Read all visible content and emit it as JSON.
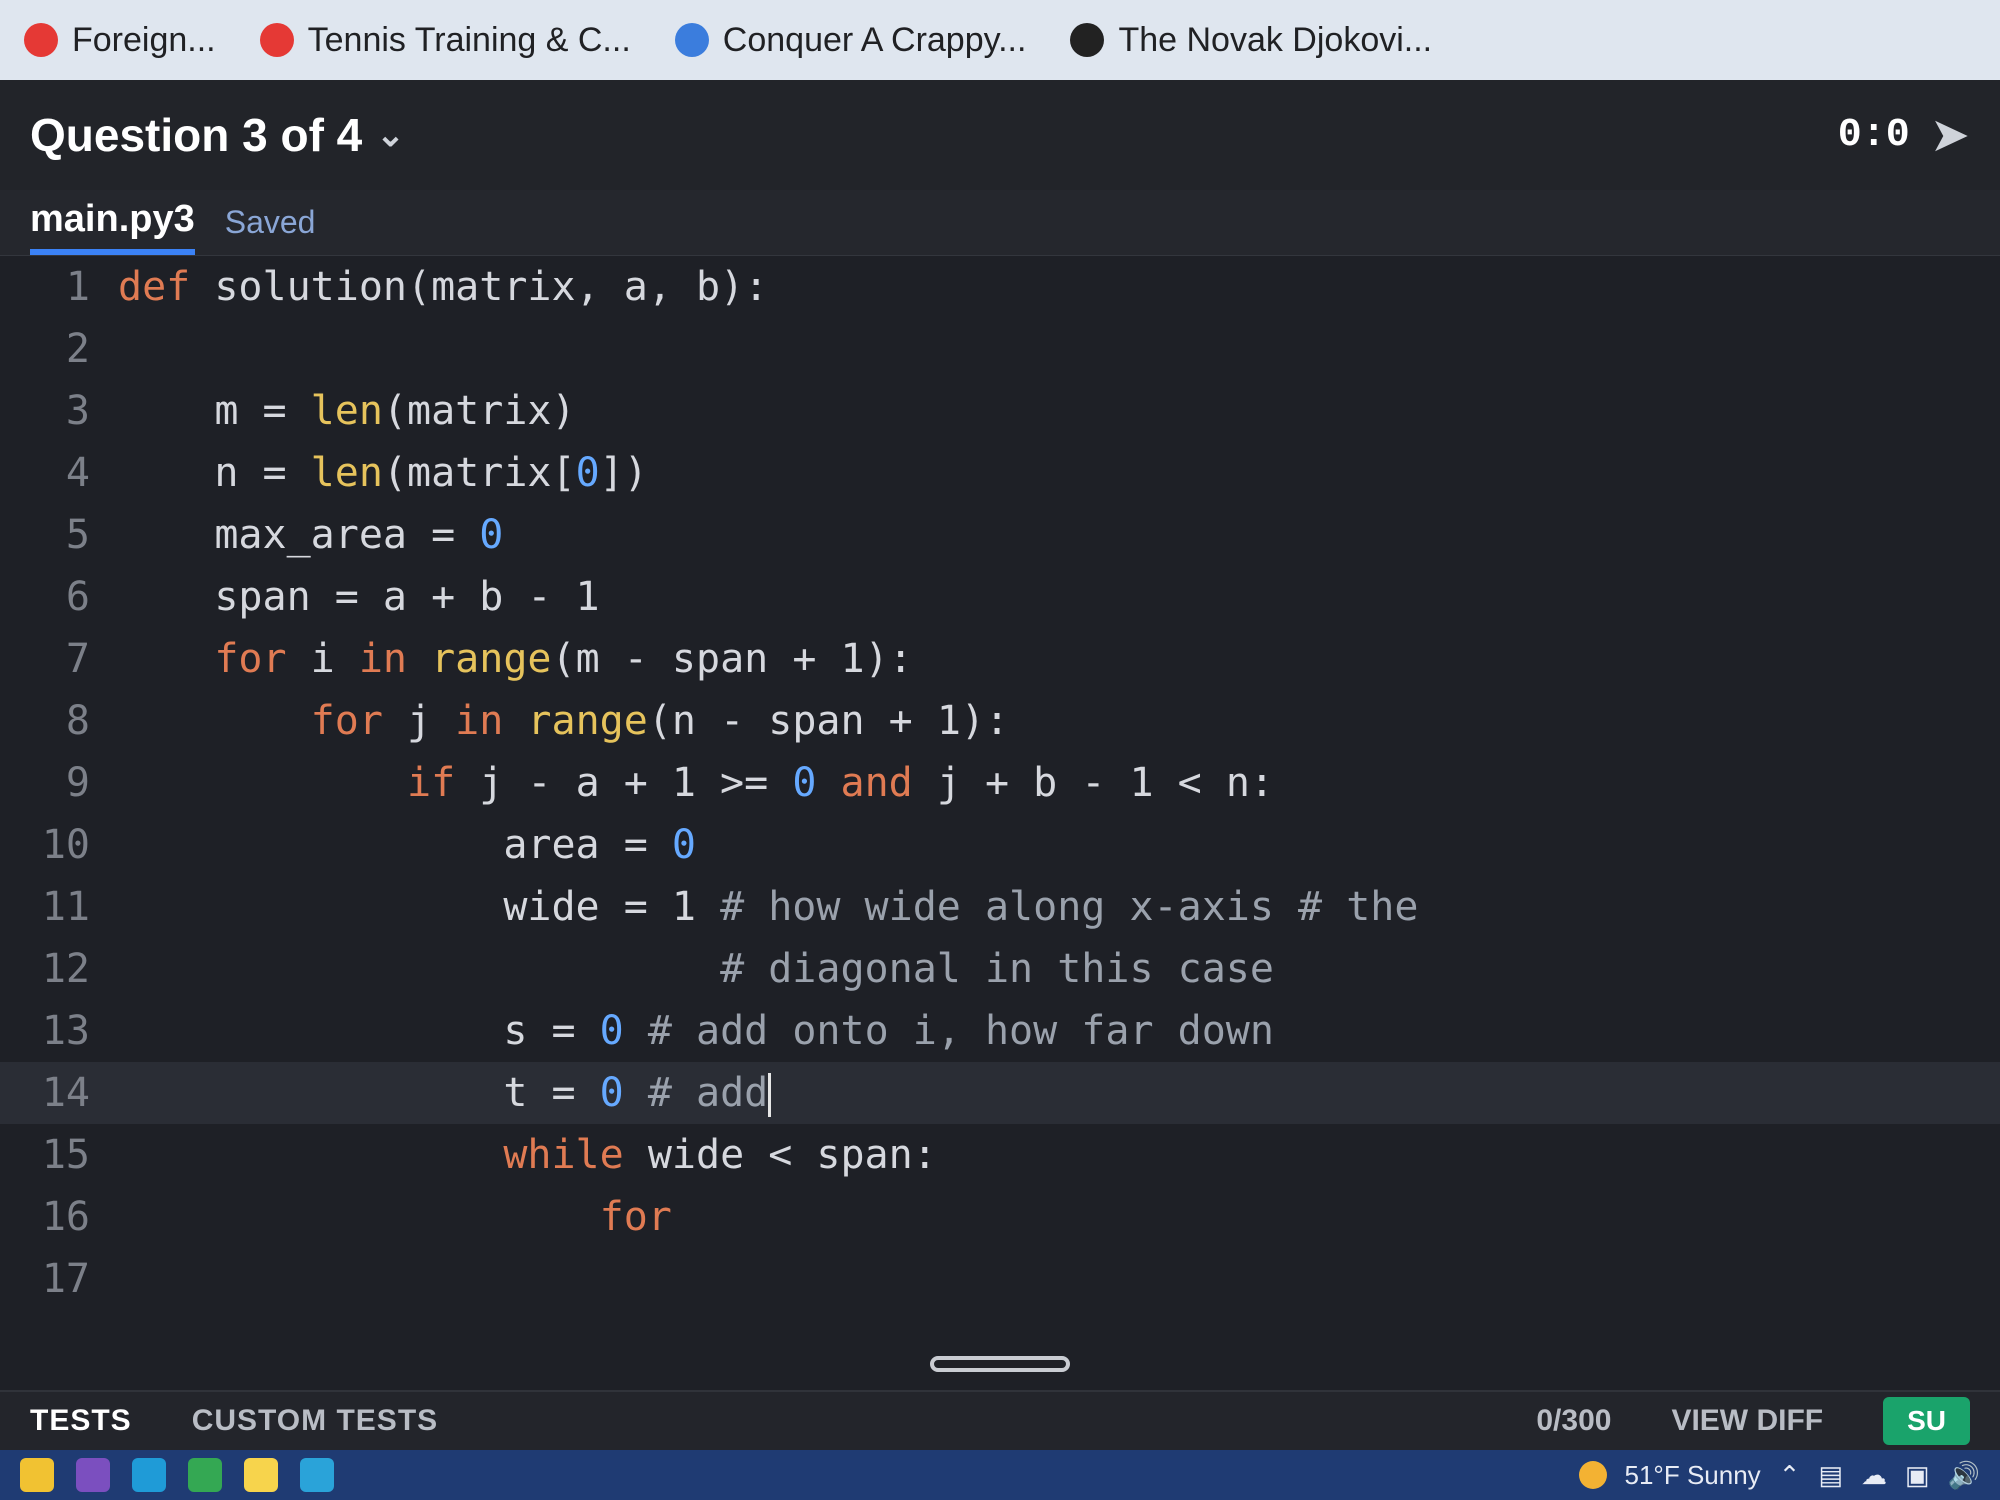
{
  "browser": {
    "bookmarks": [
      {
        "label": "Foreign...",
        "icon": "red-circle-icon"
      },
      {
        "label": "Tennis Training & C...",
        "icon": "red-circle-icon"
      },
      {
        "label": "Conquer A Crappy...",
        "icon": "blue-logo-icon"
      },
      {
        "label": "The Novak Djokovi...",
        "icon": "dark-circle-icon"
      }
    ]
  },
  "header": {
    "question": "Question 3 of 4",
    "timer": "0:0"
  },
  "editor": {
    "file_tab": "main.py3",
    "status": "Saved",
    "lines": [
      {
        "num": "1",
        "text": "def solution(matrix, a, b):"
      },
      {
        "num": "2",
        "text": ""
      },
      {
        "num": "3",
        "text": "    m = len(matrix)"
      },
      {
        "num": "4",
        "text": "    n = len(matrix[0])"
      },
      {
        "num": "5",
        "text": "    max_area = 0"
      },
      {
        "num": "6",
        "text": "    span = a + b - 1"
      },
      {
        "num": "7",
        "text": "    for i in range(m - span + 1):"
      },
      {
        "num": "8",
        "text": "        for j in range(n - span + 1):"
      },
      {
        "num": "9",
        "text": "            if j - a + 1 >= 0 and j + b - 1 < n:"
      },
      {
        "num": "10",
        "text": "                area = 0"
      },
      {
        "num": "11",
        "text": "                wide = 1 # how wide along x-axis # the"
      },
      {
        "num": "12",
        "text": "                         # diagonal in this case"
      },
      {
        "num": "13",
        "text": "                s = 0 # add onto i, how far down"
      },
      {
        "num": "14",
        "text": "                t = 0 # add"
      },
      {
        "num": "15",
        "text": "                while wide < span:"
      },
      {
        "num": "16",
        "text": "                    for"
      },
      {
        "num": "17",
        "text": ""
      }
    ]
  },
  "tests_panel": {
    "tabs": [
      "TESTS",
      "CUSTOM TESTS"
    ],
    "count": "0/300",
    "view_diff": "VIEW DIFF",
    "submit": "SU"
  },
  "taskbar": {
    "weather": "51°F Sunny"
  },
  "colors": {
    "keyword": "#e07b53",
    "function": "#e6c35c",
    "number": "#66a9ff",
    "comment": "#9aa1ac",
    "accent": "#3b82f6"
  }
}
